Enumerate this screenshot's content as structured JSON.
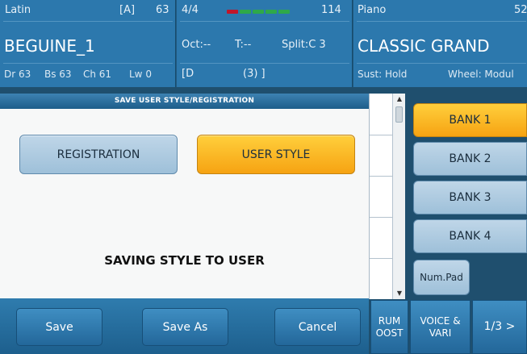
{
  "style_panel": {
    "category": "Latin",
    "variation": "[A]",
    "number": "63",
    "name": "BEGUINE_1",
    "channels": [
      "Dr 63",
      "Bs 63",
      "Ch 61",
      "Lw 0"
    ]
  },
  "mid_panel": {
    "time_signature": "4/4",
    "tempo": "114",
    "octave": "Oct:--",
    "transpose": "T:--",
    "split": "Split:C 3",
    "bracket_left": "[D",
    "bracket_right": "(3) ]",
    "tempo_colors": [
      "#c0162a",
      "#2ea84a",
      "#2ea84a",
      "#2ea84a",
      "#2ea84a"
    ]
  },
  "voice_panel": {
    "category": "Piano",
    "number": "52",
    "name": "CLASSIC GRAND",
    "sustain": "Sust: Hold",
    "wheel": "Wheel: Modul"
  },
  "dialog": {
    "title": "SAVE USER STYLE/REGISTRATION",
    "registration_label": "REGISTRATION",
    "user_style_label": "USER STYLE",
    "message": "SAVING STYLE TO USER",
    "save_label": "Save",
    "save_as_label": "Save As",
    "cancel_label": "Cancel"
  },
  "banks": [
    "BANK 1",
    "BANK 2",
    "BANK 3",
    "BANK 4"
  ],
  "selected_bank": "BANK 1",
  "numpad_label": "Num.Pad",
  "function_buttons": {
    "drum_boost_l1": "RUM",
    "drum_boost_l2": "OOST",
    "voice_vari_l1": "VOICE &",
    "voice_vari_l2": "VARI",
    "page": "1/3 >"
  },
  "colors": {
    "panel_blue": "#2c78ad",
    "selected_orange": "#f6a312",
    "button_blue": "#9ec0d9"
  }
}
